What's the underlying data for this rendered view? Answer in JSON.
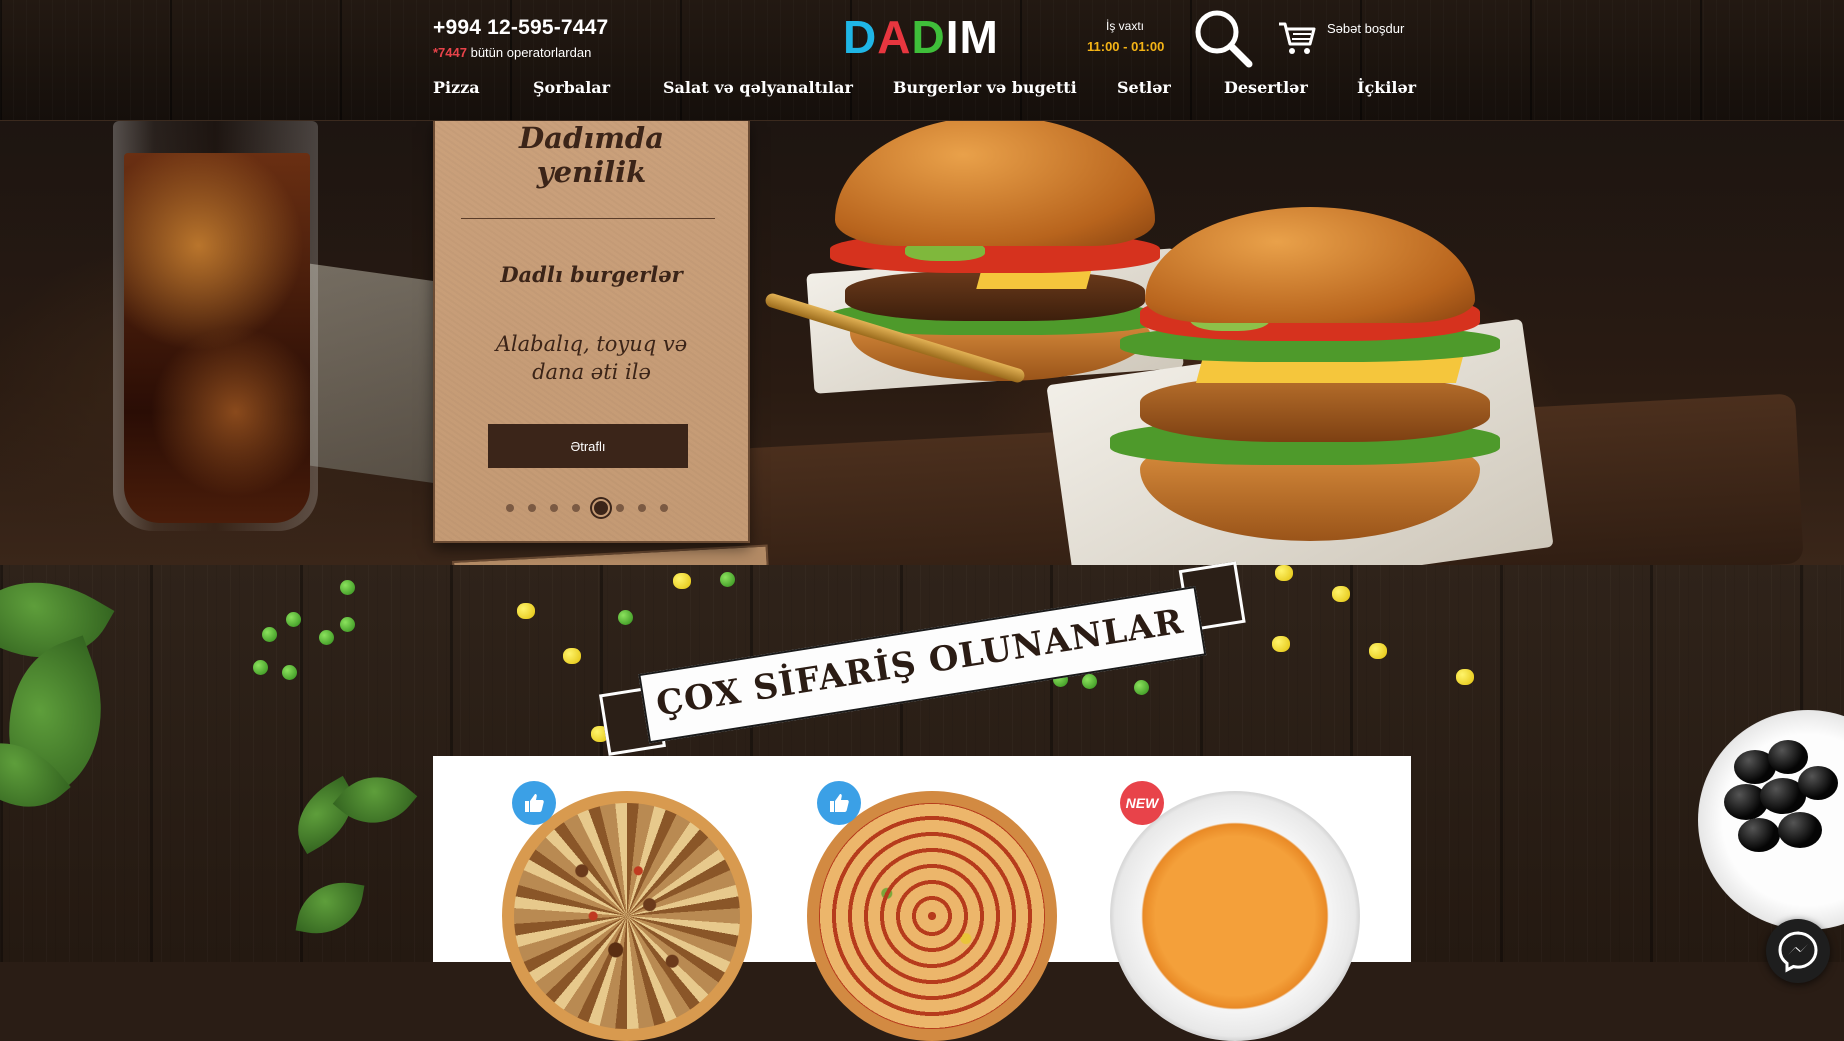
{
  "header": {
    "phone": "+994 12-595-7447",
    "phone_short": "*7447",
    "phone_note": " bütün operatorlardan",
    "logo": {
      "letters": [
        "D",
        "A",
        "D",
        "I",
        "M"
      ],
      "colors": [
        "#1fb6e6",
        "#e7363f",
        "#3fbf3a",
        "#ffffff",
        "#ffffff"
      ]
    },
    "hours_label": "İş vaxtı",
    "hours": "11:00 - 01:00",
    "search_icon": "search-icon",
    "cart_icon": "cart-icon",
    "cart_label": "Səbət boşdur"
  },
  "nav": {
    "items": [
      {
        "label": "Pizza"
      },
      {
        "label": "Şorbalar"
      },
      {
        "label": "Salat və qəlyanaltılar"
      },
      {
        "label": "Burgerlər və bugetti"
      },
      {
        "label": "Setlər"
      },
      {
        "label": "Desertlər"
      },
      {
        "label": "İçkilər"
      }
    ]
  },
  "hero": {
    "card": {
      "title_line1": "Dadımda",
      "title_line2": "yenilik",
      "subtitle": "Dadlı burgerlər",
      "desc_line1": "Alabalıq, toyuq və",
      "desc_line2": "dana əti ilə",
      "button": "Ətraflı",
      "slide_count": 8,
      "active_slide": 5
    }
  },
  "section": {
    "title": "ÇOX SİFARİŞ OLUNANLAR",
    "products": [
      {
        "badge": "like-icon",
        "badge_color": "#3ba0e6",
        "kind": "pizza-meat"
      },
      {
        "badge": "like-icon",
        "badge_color": "#3ba0e6",
        "kind": "pizza-sausage"
      },
      {
        "badge_text": "NEW",
        "badge_color": "#e8434a",
        "kind": "soup"
      }
    ]
  },
  "widgets": {
    "messenger_icon": "messenger-icon"
  },
  "colors": {
    "accent_yellow": "#f4b416",
    "accent_red": "#e8434a",
    "card_bg": "#c49a74",
    "button_dark": "#3b2519"
  }
}
